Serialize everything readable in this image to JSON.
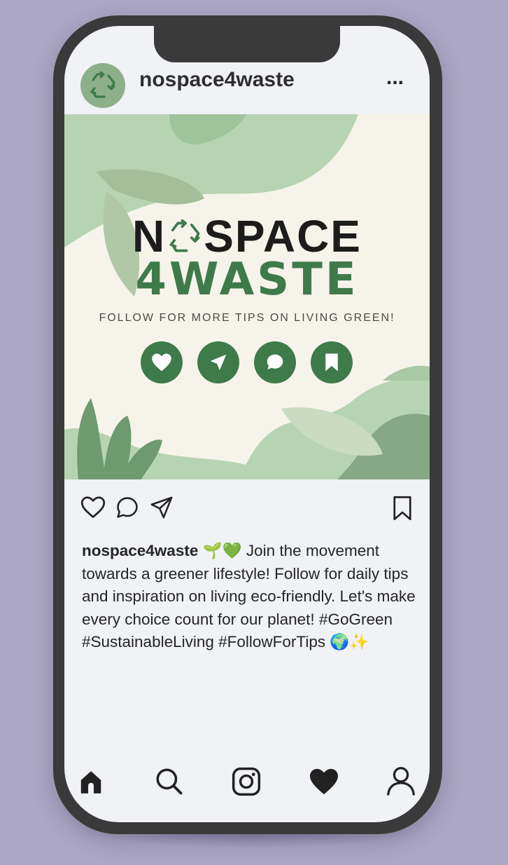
{
  "profile": {
    "username": "nospace4waste",
    "more_label": "..."
  },
  "post_image": {
    "brand_line1_prefix": "N",
    "brand_line1_suffix": "SPACE",
    "brand_line2": "4WASTE",
    "tagline": "FOLLOW FOR MORE TIPS ON LIVING GREEN!",
    "icons": [
      "heart-icon",
      "send-icon",
      "comment-icon",
      "bookmark-icon"
    ]
  },
  "caption": {
    "username": "nospace4waste",
    "emoji_start": "🌱💚",
    "text": " Join the movement towards a greener lifestyle! Follow for daily tips and inspiration on living eco-friendly. Let's make every choice count for our planet! #GoGreen #SustainableLiving #FollowForTips ",
    "emoji_end": "🌍✨"
  },
  "actions": [
    "like-icon",
    "comment-icon",
    "share-icon",
    "save-icon"
  ],
  "bottom_nav": [
    "home-icon",
    "search-icon",
    "instagram-icon",
    "heart-icon",
    "profile-icon"
  ],
  "colors": {
    "background": "#aba7c4",
    "phone_frame": "#3a3a3a",
    "screen": "#f0f2f6",
    "brand_green": "#3f7a4a",
    "light_green": "#b7d4b2",
    "mid_green": "#86a884",
    "cream": "#f6f4ea"
  }
}
